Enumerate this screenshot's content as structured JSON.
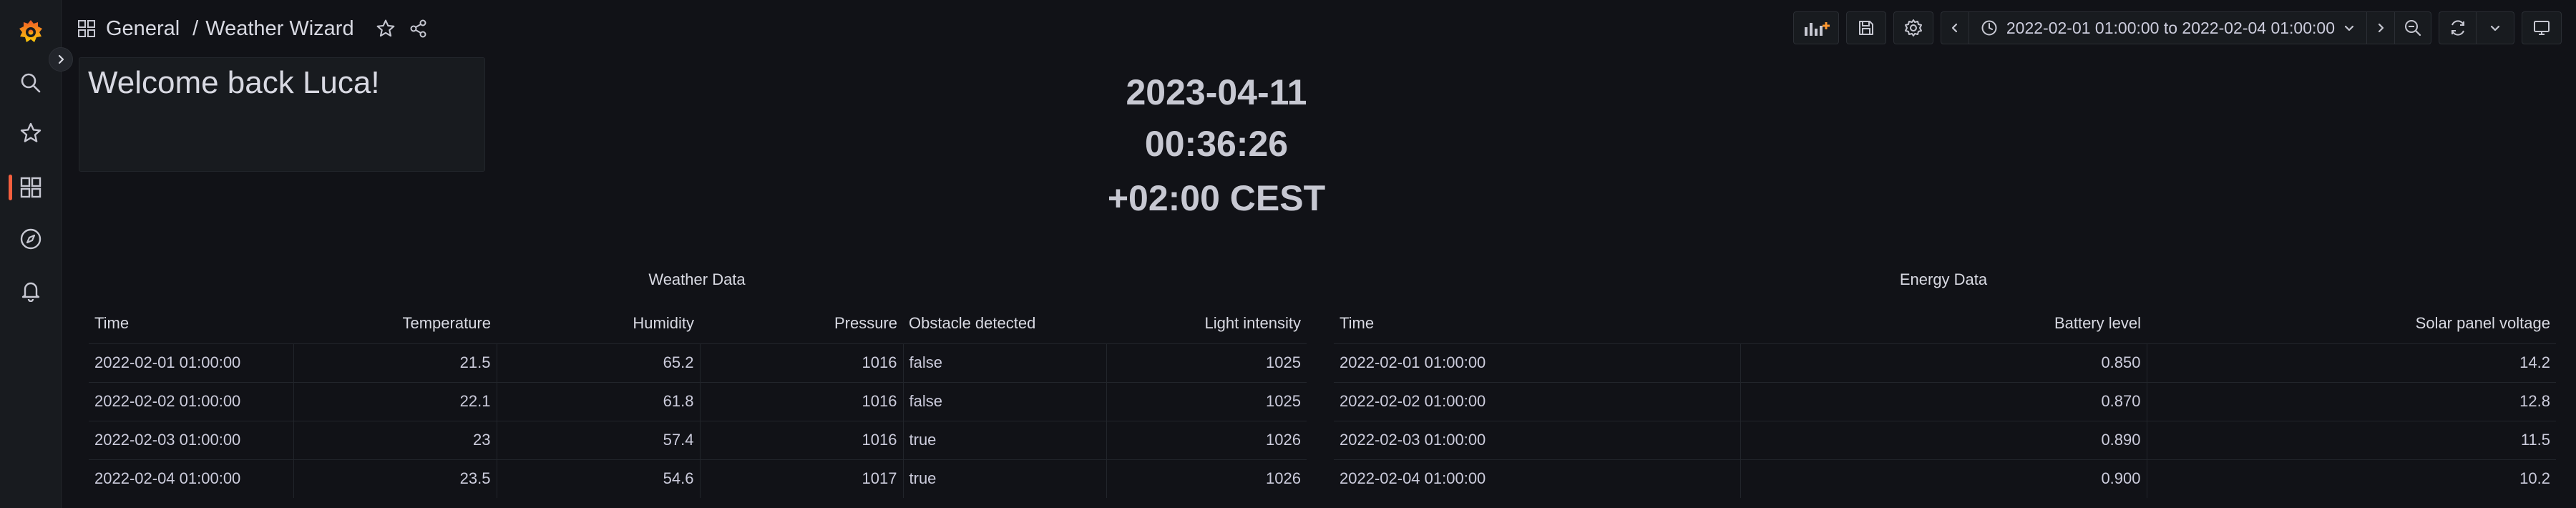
{
  "breadcrumb": {
    "folder": "General",
    "dashboard": "Weather Wizard",
    "separator": "/"
  },
  "toolbar": {
    "time_range": "2022-02-01 01:00:00 to 2022-02-04 01:00:00"
  },
  "welcome": {
    "text": "Welcome back Luca!"
  },
  "clock": {
    "date": "2023-04-11",
    "time": "00:36:26",
    "timezone": "+02:00 CEST"
  },
  "colors": {
    "accent": "#f55f3e",
    "background": "#111217",
    "panel": "#181b1f"
  },
  "weather": {
    "title": "Weather Data",
    "columns": [
      "Time",
      "Temperature",
      "Humidity",
      "Pressure",
      "Obstacle detected",
      "Light intensity"
    ],
    "rows": [
      [
        "2022-02-01 01:00:00",
        "21.5",
        "65.2",
        "1016",
        "false",
        "1025"
      ],
      [
        "2022-02-02 01:00:00",
        "22.1",
        "61.8",
        "1016",
        "false",
        "1025"
      ],
      [
        "2022-02-03 01:00:00",
        "23",
        "57.4",
        "1016",
        "true",
        "1026"
      ],
      [
        "2022-02-04 01:00:00",
        "23.5",
        "54.6",
        "1017",
        "true",
        "1026"
      ]
    ]
  },
  "energy": {
    "title": "Energy Data",
    "columns": [
      "Time",
      "Battery level",
      "Solar panel voltage"
    ],
    "rows": [
      [
        "2022-02-01 01:00:00",
        "0.850",
        "14.2"
      ],
      [
        "2022-02-02 01:00:00",
        "0.870",
        "12.8"
      ],
      [
        "2022-02-03 01:00:00",
        "0.890",
        "11.5"
      ],
      [
        "2022-02-04 01:00:00",
        "0.900",
        "10.2"
      ]
    ]
  }
}
